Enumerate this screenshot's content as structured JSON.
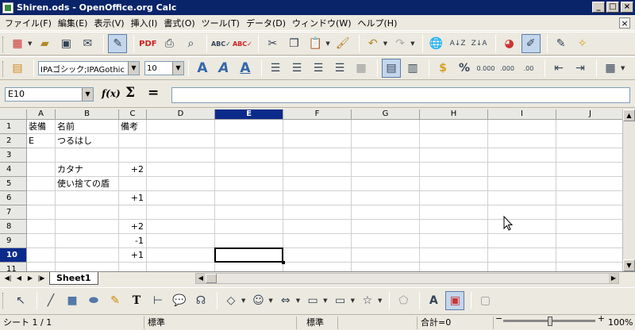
{
  "window": {
    "title": "Shiren.ods - OpenOffice.org Calc"
  },
  "menu": [
    "ファイル(F)",
    "編集(E)",
    "表示(V)",
    "挿入(I)",
    "書式(O)",
    "ツール(T)",
    "データ(D)",
    "ウィンドウ(W)",
    "ヘルプ(H)"
  ],
  "toolbar_format": {
    "font_name": "IPAゴシック;IPAGothic",
    "font_size": "10"
  },
  "formula_bar": {
    "name_box": "E10",
    "function_wizard": "f(x)",
    "sum_symbol": "Σ",
    "equals_symbol": "=",
    "input_value": ""
  },
  "sheet": {
    "columns": [
      "A",
      "B",
      "C",
      "D",
      "E",
      "F",
      "G",
      "H",
      "I",
      "J"
    ],
    "selected_column": "E",
    "rows": [
      "1",
      "2",
      "3",
      "4",
      "5",
      "6",
      "7",
      "8",
      "9",
      "10",
      "11"
    ],
    "selected_row": "10",
    "cells": {
      "A1": "装備",
      "B1": "名前",
      "C1": "備考",
      "A2": "E",
      "B2": "つるはし",
      "B4": "カタナ",
      "C4": "+2",
      "B5": "使い捨ての盾",
      "C6": "+1",
      "C8": "+2",
      "C9": "-1",
      "C10": "+1"
    }
  },
  "tabs": {
    "sheet1": "Sheet1"
  },
  "status": {
    "sheet_pos": "シート 1 / 1",
    "style": "標準",
    "mode": "標準",
    "sum": "合計=0",
    "zoom": "100%",
    "zoom_level": 100
  }
}
